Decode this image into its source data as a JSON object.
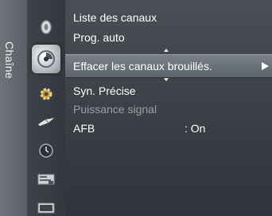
{
  "side_tab": {
    "label": "Chaîne"
  },
  "nav_icons": [
    {
      "name": "input-icon"
    },
    {
      "name": "channel-icon"
    },
    {
      "name": "setup-icon"
    },
    {
      "name": "satellite-icon"
    },
    {
      "name": "clock-icon"
    },
    {
      "name": "picture-icon"
    },
    {
      "name": "sound-icon"
    }
  ],
  "menu": {
    "items": [
      {
        "label": "Liste des canaux"
      },
      {
        "label": "Prog. auto"
      },
      {
        "label": "Effacer les canaux brouillés."
      },
      {
        "label": "Syn. Précise"
      },
      {
        "label": "Puissance signal"
      },
      {
        "label": "AFB",
        "value": ": On"
      }
    ]
  }
}
